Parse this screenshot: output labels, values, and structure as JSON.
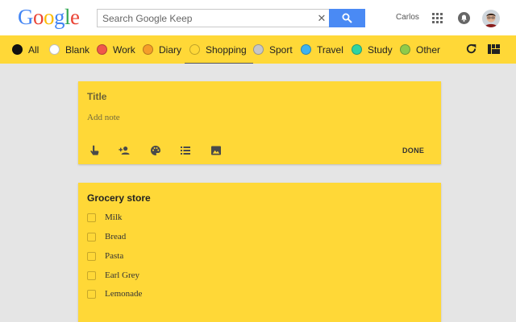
{
  "header": {
    "logo_letters": [
      {
        "ch": "G",
        "color": "#4285f4"
      },
      {
        "ch": "o",
        "color": "#ea4335"
      },
      {
        "ch": "o",
        "color": "#fbbc05"
      },
      {
        "ch": "g",
        "color": "#4285f4"
      },
      {
        "ch": "l",
        "color": "#34a853"
      },
      {
        "ch": "e",
        "color": "#ea4335"
      }
    ],
    "search_placeholder": "Search Google Keep",
    "search_clear": "✕",
    "user_name": "Carlos"
  },
  "labels": [
    {
      "name": "All",
      "color": "#111111"
    },
    {
      "name": "Blank",
      "color": "#ffffff"
    },
    {
      "name": "Work",
      "color": "#f0584a"
    },
    {
      "name": "Diary",
      "color": "#f59e2a"
    },
    {
      "name": "Shopping",
      "color": "#ffd837",
      "active": true
    },
    {
      "name": "Sport",
      "color": "#c7c7c7"
    },
    {
      "name": "Travel",
      "color": "#3db3f0"
    },
    {
      "name": "Study",
      "color": "#2fd4a2"
    },
    {
      "name": "Other",
      "color": "#8fcb4a"
    }
  ],
  "new_note": {
    "title_placeholder": "Title",
    "body_placeholder": "Add note",
    "done_label": "DONE"
  },
  "list_note": {
    "title": "Grocery store",
    "items": [
      "Milk",
      "Bread",
      "Pasta",
      "Earl Grey",
      "Lemonade"
    ]
  },
  "colors": {
    "accent_yellow": "#ffd837",
    "search_button": "#4a8af4"
  }
}
